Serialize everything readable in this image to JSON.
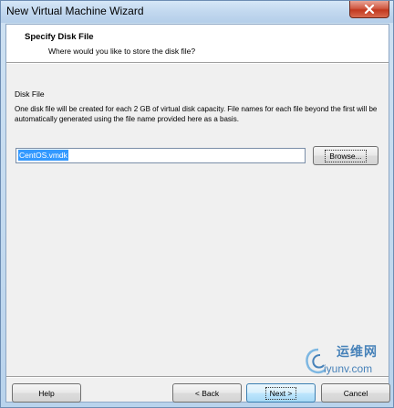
{
  "window": {
    "title": "New Virtual Machine Wizard"
  },
  "header": {
    "title": "Specify Disk File",
    "subtitle": "Where would you like to store the disk file?"
  },
  "disk_file": {
    "group_label": "Disk File",
    "description": "One disk file will be created for each 2 GB of virtual disk capacity. File names for each file beyond the first will be automatically generated using the file name provided here as a basis.",
    "value": "CentOS.vmdk",
    "browse_label": "Browse..."
  },
  "footer": {
    "help_label": "Help",
    "back_label": "< Back",
    "next_label": "Next >",
    "cancel_label": "Cancel"
  },
  "watermark": {
    "cn_text": "运维网",
    "en_text": "iyunv.com"
  },
  "icons": {
    "close": "close-icon",
    "watermark_logo": "swirl-logo-icon"
  }
}
